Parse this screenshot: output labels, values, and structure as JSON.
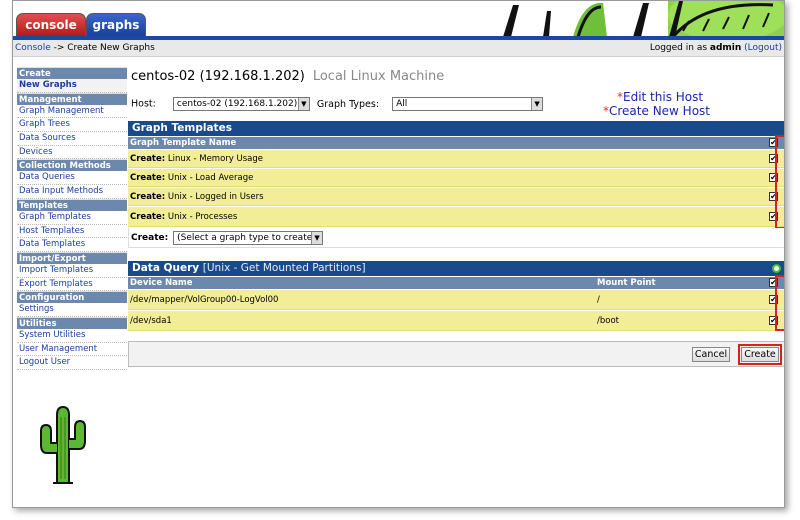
{
  "tabs": [
    {
      "label": "console"
    },
    {
      "label": "graphs"
    }
  ],
  "breadcrumb": {
    "root": "Console",
    "separator": " -> ",
    "current": "Create New Graphs"
  },
  "login": {
    "prefix": "Logged in as ",
    "user": "admin",
    "logout": "(Logout)"
  },
  "sidebar": {
    "sections": [
      {
        "header": "Create",
        "items": [
          {
            "label": "New Graphs",
            "active": true
          }
        ]
      },
      {
        "header": "Management",
        "items": [
          {
            "label": "Graph Management"
          },
          {
            "label": "Graph Trees"
          },
          {
            "label": "Data Sources"
          },
          {
            "label": "Devices"
          }
        ]
      },
      {
        "header": "Collection Methods",
        "items": [
          {
            "label": "Data Queries"
          },
          {
            "label": "Data Input Methods"
          }
        ]
      },
      {
        "header": "Templates",
        "items": [
          {
            "label": "Graph Templates"
          },
          {
            "label": "Host Templates"
          },
          {
            "label": "Data Templates"
          }
        ]
      },
      {
        "header": "Import/Export",
        "items": [
          {
            "label": "Import Templates"
          },
          {
            "label": "Export Templates"
          }
        ]
      },
      {
        "header": "Configuration",
        "items": [
          {
            "label": "Settings"
          }
        ]
      },
      {
        "header": "Utilities",
        "items": [
          {
            "label": "System Utilities"
          },
          {
            "label": "User Management"
          },
          {
            "label": "Logout User"
          }
        ]
      }
    ]
  },
  "host": {
    "title": "centos-02 (192.168.1.202)",
    "description": "Local Linux Machine",
    "host_label": "Host:",
    "host_value": "centos-02 (192.168.1.202)",
    "graph_types_label": "Graph Types:",
    "graph_types_value": "All",
    "edit_link": "Edit this Host",
    "create_link": "Create New Host",
    "star": "*"
  },
  "graph_templates": {
    "title": "Graph Templates",
    "column": "Graph Template Name",
    "rows": [
      {
        "prefix": "Create:",
        "name": "Linux - Memory Usage",
        "checked": true
      },
      {
        "prefix": "Create:",
        "name": "Unix - Load Average",
        "checked": true
      },
      {
        "prefix": "Create:",
        "name": "Unix - Logged in Users",
        "checked": true
      },
      {
        "prefix": "Create:",
        "name": "Unix - Processes",
        "checked": true
      }
    ],
    "create_label": "Create:",
    "create_select": "(Select a graph type to create)"
  },
  "data_query": {
    "title": "Data Query",
    "subtitle": "[Unix - Get Mounted Partitions]",
    "col_device": "Device Name",
    "col_mount": "Mount Point",
    "rows": [
      {
        "device": "/dev/mapper/VolGroup00-LogVol00",
        "mount": "/",
        "checked": true
      },
      {
        "device": "/dev/sda1",
        "mount": "/boot",
        "checked": true
      }
    ]
  },
  "buttons": {
    "cancel": "Cancel",
    "create": "Create"
  },
  "colors": {
    "panel_header": "#1a4a8c",
    "column_header": "#6d88ad",
    "row_highlight": "#f2ed97",
    "highlight_box": "#d82020",
    "link": "#1a3fa0"
  }
}
